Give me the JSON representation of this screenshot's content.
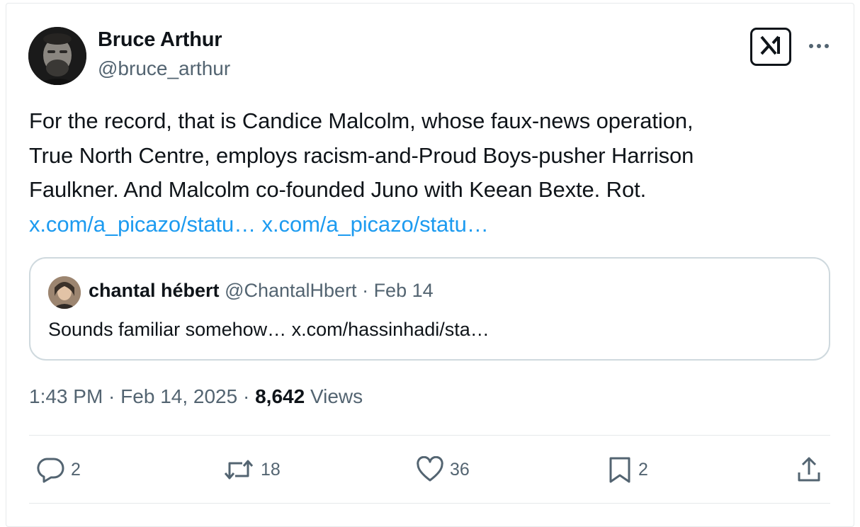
{
  "author": {
    "name": "Bruce Arthur",
    "handle": "@bruce_arthur"
  },
  "icons": {
    "grok": "grok-icon",
    "more": "more-icon"
  },
  "tweet": {
    "lines": [
      "For the record, that is Candice Malcolm, whose faux-news operation,",
      "True North Centre, employs racism-and-Proud Boys-pusher Harrison",
      "Faulkner. And Malcolm co-founded Juno with Keean Bexte. Rot."
    ],
    "link1": "x.com/a_picazo/statu…",
    "link2": "x.com/a_picazo/statu…"
  },
  "quote": {
    "name": "chantal hébert",
    "handle": "@ChantalHbert",
    "separator": " · ",
    "date": "Feb 14",
    "text": "Sounds familiar somehow… x.com/hassinhadi/sta…"
  },
  "meta": {
    "time": "1:43 PM",
    "sep": " · ",
    "date": "Feb 14, 2025",
    "views_count": "8,642",
    "views_label": " Views"
  },
  "actions": {
    "replies": "2",
    "reposts": "18",
    "likes": "36",
    "bookmarks": "2"
  },
  "colors": {
    "link": "#1d9bf0",
    "secondary_text": "#536471",
    "primary_text": "#0f1419",
    "border": "#cfd9de"
  }
}
